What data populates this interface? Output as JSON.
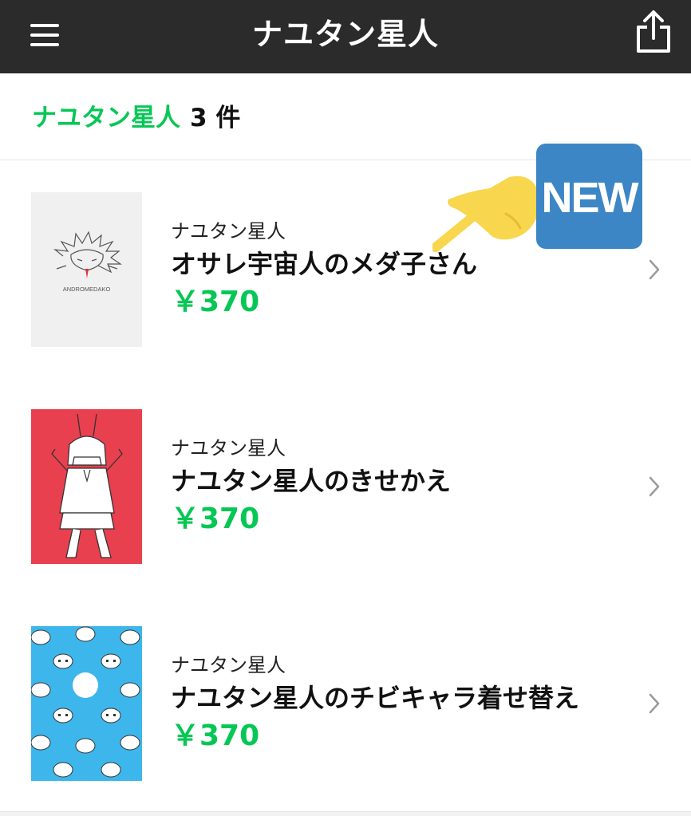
{
  "header": {
    "title": "ナユタン星人",
    "menu_icon": "hamburger-menu-icon",
    "share_icon": "share-icon"
  },
  "results": {
    "keyword": "ナユタン星人",
    "count": "3 件"
  },
  "badge": {
    "label": "NEW",
    "color": "#3d86c6"
  },
  "items": [
    {
      "author": "ナユタン星人",
      "title": "オサレ宇宙人のメダ子さん",
      "price": "￥370",
      "thumb_text": "ANDROMEDAKO",
      "thumb_bg": "#f0f0f0"
    },
    {
      "author": "ナユタン星人",
      "title": "ナユタン星人のきせかえ",
      "price": "￥370",
      "thumb_bg": "#e8404f"
    },
    {
      "author": "ナユタン星人",
      "title": "ナユタン星人のチビキャラ着せ替え",
      "price": "￥370",
      "thumb_bg": "#3db6ec"
    }
  ],
  "colors": {
    "accent_green": "#06c755",
    "header_bg": "#2b2b2b"
  }
}
